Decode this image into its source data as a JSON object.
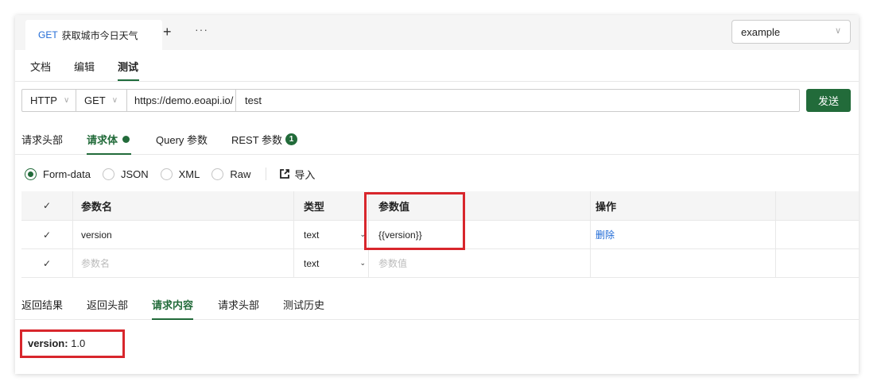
{
  "tab": {
    "method": "GET",
    "title": "获取城市今日天气",
    "plus": "+",
    "more": "···"
  },
  "env": {
    "value": "example",
    "chevron": "∨"
  },
  "mode_tabs": [
    "文档",
    "编辑",
    "测试"
  ],
  "url": {
    "protocol": "HTTP",
    "method": "GET",
    "host": "https://demo.eoapi.io/",
    "path": "test",
    "caret": "∨",
    "send": "发送"
  },
  "param_tabs": {
    "headers": "请求头部",
    "body": "请求体",
    "query": "Query 参数",
    "rest": "REST 参数",
    "rest_count": "1"
  },
  "body_types": {
    "form": "Form-data",
    "json": "JSON",
    "xml": "XML",
    "raw": "Raw",
    "import": "导入"
  },
  "table": {
    "headers": {
      "check": "✓",
      "name": "参数名",
      "type": "类型",
      "value": "参数值",
      "action": "操作"
    },
    "rows": [
      {
        "check": "✓",
        "name": "version",
        "type": "text",
        "dd": "⌄",
        "value": "{{version}}",
        "action": "删除"
      },
      {
        "check": "✓",
        "name": "参数名",
        "type": "text",
        "dd": "⌄",
        "value": "参数值",
        "action": ""
      }
    ]
  },
  "resp_tabs": [
    "返回结果",
    "返回头部",
    "请求内容",
    "请求头部",
    "测试历史"
  ],
  "result": {
    "key": "version:",
    "value": "1.0"
  },
  "colors": {
    "accent": "#226b3a",
    "link": "#1f6ad6",
    "annotation": "#d8262c"
  }
}
